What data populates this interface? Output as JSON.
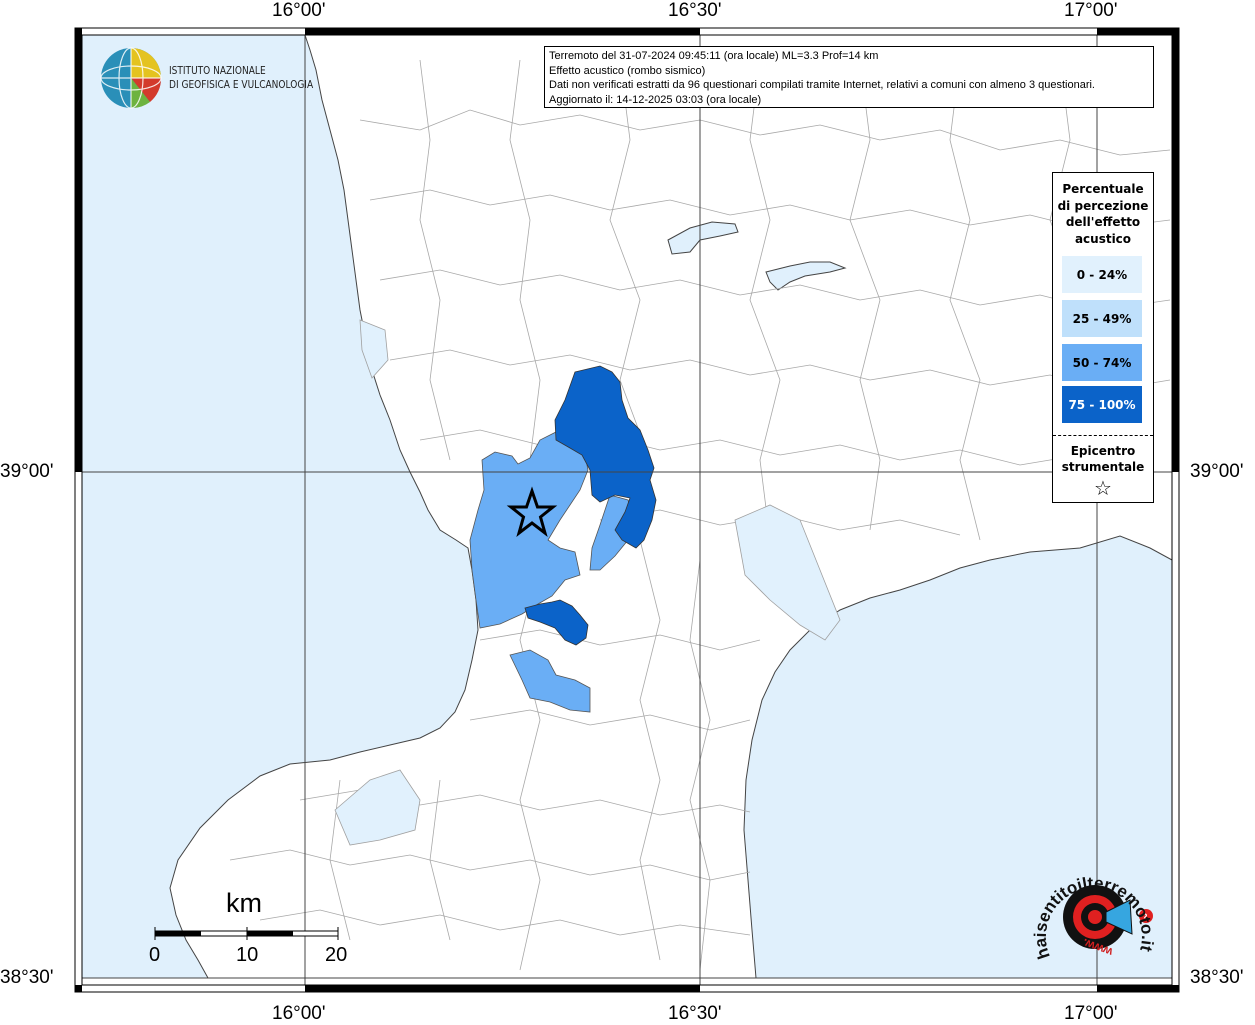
{
  "header": {
    "line1": "Terremoto del 31-07-2024 09:45:11 (ora locale) ML=3.3 Prof=14 km",
    "line2": "Effetto acustico (rombo sismico)",
    "line3": "Dati non verificati estratti da 96 questionari compilati tramite Internet, relativi a comuni con almeno 3 questionari.",
    "line4": "Aggiornato il: 14-12-2025 03:03 (ora locale)"
  },
  "axes": {
    "top": [
      "16°00'",
      "16°30'",
      "17°00'"
    ],
    "bottom": [
      "16°00'",
      "16°30'",
      "17°00'"
    ],
    "left": [
      "39°00'",
      "38°30'"
    ],
    "right": [
      "39°00'",
      "38°30'"
    ]
  },
  "institute": {
    "line1": "ISTITUTO NAZIONALE",
    "line2": "DI GEOFISICA E VULCANOLOGIA"
  },
  "legend": {
    "title_lines": [
      "Percentuale",
      "di percezione",
      "dell'effetto",
      "acustico"
    ],
    "classes": [
      {
        "label": "0 - 24%",
        "color": "#e1f1fd",
        "text_color": "#000000"
      },
      {
        "label": "25 - 49%",
        "color": "#bfe0fb",
        "text_color": "#000000"
      },
      {
        "label": "50 - 74%",
        "color": "#6aaef5",
        "text_color": "#000000"
      },
      {
        "label": "75 - 100%",
        "color": "#0b63c9",
        "text_color": "#ffffff"
      }
    ],
    "epicenter_lines": [
      "Epicentro",
      "strumentale"
    ],
    "epicenter_symbol": "☆"
  },
  "scalebar": {
    "unit": "km",
    "labels": [
      "0",
      "10",
      "20"
    ]
  },
  "watermark": {
    "brand": "haisentitoilterremoto.it",
    "url_prefix": "www."
  },
  "colors": {
    "sea": "#e0f0fc",
    "land": "#ffffff",
    "borders": "#9a9a9a"
  }
}
